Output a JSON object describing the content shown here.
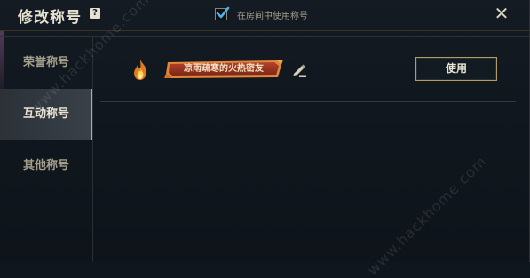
{
  "header": {
    "title": "修改称号",
    "help_icon": "?",
    "room_toggle_label": "在房间中使用称号",
    "room_toggle_checked": true,
    "close_icon": "✕"
  },
  "sidebar": {
    "items": [
      {
        "label": "荣誉称号",
        "active": false
      },
      {
        "label": "互动称号",
        "active": true
      },
      {
        "label": "其他称号",
        "active": false
      }
    ]
  },
  "title_row": {
    "badge_text": "凉雨疏寒的火热密友",
    "use_button": "使用"
  },
  "watermark": {
    "text_1": "www.hackhome.com",
    "text_2": "www.hackhome.com"
  },
  "colors": {
    "accent_gold": "#c8aa6e",
    "badge_red": "#8c2a1c",
    "badge_orange": "#e0873a"
  }
}
